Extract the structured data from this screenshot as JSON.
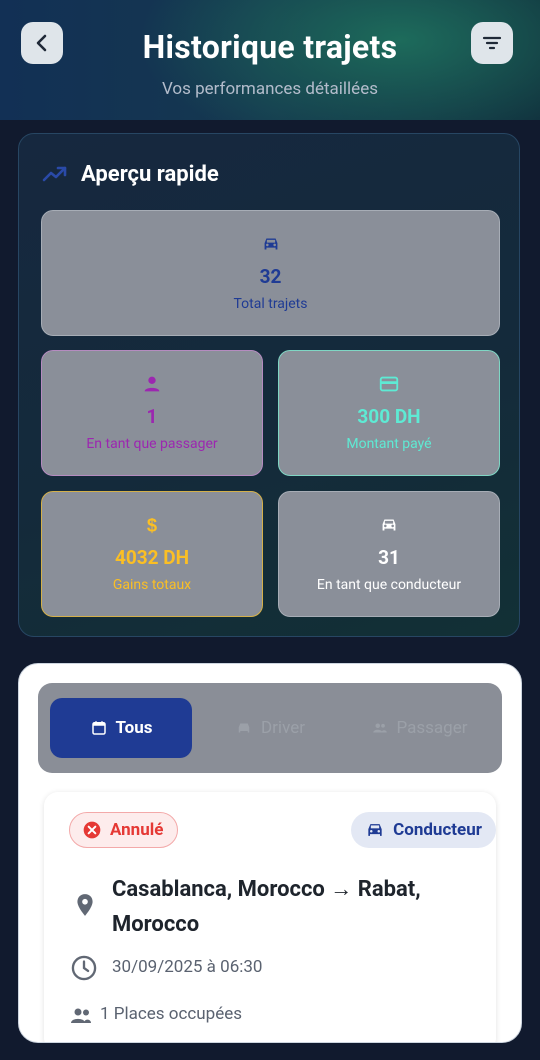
{
  "header": {
    "title": "Historique trajets",
    "subtitle": "Vos performances détaillées",
    "back_icon": "chevron-left-icon",
    "filter_icon": "filter-icon"
  },
  "overview": {
    "title": "Aperçu rapide",
    "icon": "trending-up-icon",
    "stats": [
      {
        "id": "total",
        "icon": "car-icon",
        "value": "32",
        "label": "Total trajets",
        "color": "#1f3b94"
      },
      {
        "id": "passenger",
        "icon": "person-icon",
        "value": "1",
        "label": "En tant que passager",
        "color": "#9c27b0"
      },
      {
        "id": "paid",
        "icon": "credit-card-icon",
        "value": "300 DH",
        "label": "Montant payé",
        "color": "#5eead4"
      },
      {
        "id": "earnings",
        "icon": "dollar-icon",
        "value": "4032 DH",
        "label": "Gains totaux",
        "color": "#fbbf24"
      },
      {
        "id": "driver",
        "icon": "car-icon",
        "value": "31",
        "label": "En tant que conducteur",
        "color": "#ffffff"
      }
    ]
  },
  "tabs": [
    {
      "label": "Tous",
      "icon": "calendar-icon",
      "active": true
    },
    {
      "label": "Driver",
      "icon": "car-icon",
      "active": false
    },
    {
      "label": "Passager",
      "icon": "people-icon",
      "active": false
    }
  ],
  "trip": {
    "status": "Annulé",
    "role": "Conducteur",
    "route": "Casablanca, Morocco → Rabat, Morocco",
    "datetime": "30/09/2025 à 06:30",
    "seats": "1 Places occupées"
  }
}
